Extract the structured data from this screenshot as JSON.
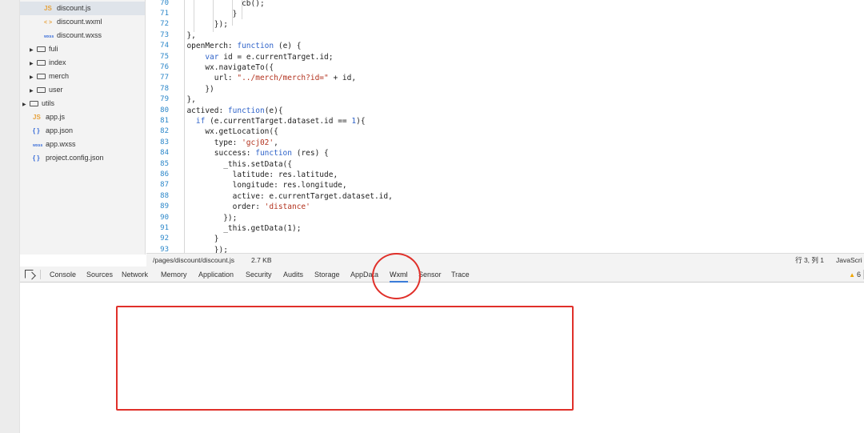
{
  "file_tree": {
    "items": [
      {
        "kind": "js",
        "icon": "JS",
        "label": "discount.js",
        "active": true
      },
      {
        "kind": "wxml",
        "icon": "< >",
        "label": "discount.wxml"
      },
      {
        "kind": "wxss",
        "icon": "wxss",
        "label": "discount.wxss"
      },
      {
        "kind": "folder",
        "label": "fuli"
      },
      {
        "kind": "folder",
        "label": "index"
      },
      {
        "kind": "folder",
        "label": "merch"
      },
      {
        "kind": "folder",
        "label": "user"
      },
      {
        "kind": "folder",
        "label": "utils"
      },
      {
        "kind": "js",
        "icon": "JS",
        "label": "app.js"
      },
      {
        "kind": "json",
        "icon": "{ }",
        "label": "app.json"
      },
      {
        "kind": "wxss",
        "icon": "wxss",
        "label": "app.wxss"
      },
      {
        "kind": "json",
        "icon": "{ }",
        "label": "project.config.json"
      }
    ]
  },
  "editor": {
    "lines": [
      {
        "num": "70",
        "text": "              cb();"
      },
      {
        "num": "71",
        "text": "            }"
      },
      {
        "num": "72",
        "text": "        });"
      },
      {
        "num": "73",
        "text": "  },"
      },
      {
        "num": "74",
        "text": "  openMerch: function (e) {"
      },
      {
        "num": "75",
        "text": "      var id = e.currentTarget.id;"
      },
      {
        "num": "76",
        "text": "      wx.navigateTo({"
      },
      {
        "num": "77",
        "text": "        url: \"../merch/merch?id=\" + id,"
      },
      {
        "num": "78",
        "text": "      })"
      },
      {
        "num": "79",
        "text": "  },"
      },
      {
        "num": "80",
        "text": "  actived: function(e){"
      },
      {
        "num": "81",
        "text": "    if (e.currentTarget.dataset.id == 1){"
      },
      {
        "num": "82",
        "text": "      wx.getLocation({"
      },
      {
        "num": "83",
        "text": "        type: 'gcj02',"
      },
      {
        "num": "84",
        "text": "        success: function (res) {"
      },
      {
        "num": "85",
        "text": "          _this.setData({"
      },
      {
        "num": "86",
        "text": "            latitude: res.latitude,"
      },
      {
        "num": "87",
        "text": "            longitude: res.longitude,"
      },
      {
        "num": "88",
        "text": "            active: e.currentTarget.dataset.id,"
      },
      {
        "num": "89",
        "text": "            order: 'distance'"
      },
      {
        "num": "90",
        "text": "          });"
      },
      {
        "num": "91",
        "text": "          _this.getData(1);"
      },
      {
        "num": "92",
        "text": "        }"
      },
      {
        "num": "93",
        "text": "        });"
      }
    ]
  },
  "statusbar": {
    "path": "/pages/discount/discount.js",
    "size": "2.7 KB",
    "position": "行 3, 列 1",
    "language": "JavaScri"
  },
  "devtools": {
    "tabs": [
      "Console",
      "Sources",
      "Network",
      "Memory",
      "Application",
      "Security",
      "Audits",
      "Storage",
      "AppData",
      "Wxml",
      "Sensor",
      "Trace"
    ],
    "selected_tab": "Wxml",
    "warning_count": "6"
  },
  "colors": {
    "keyword": "#2f63c9",
    "string": "#b3331f",
    "number": "#2f63c9",
    "line_number": "#2a86c9",
    "annotation": "#e0302a"
  }
}
